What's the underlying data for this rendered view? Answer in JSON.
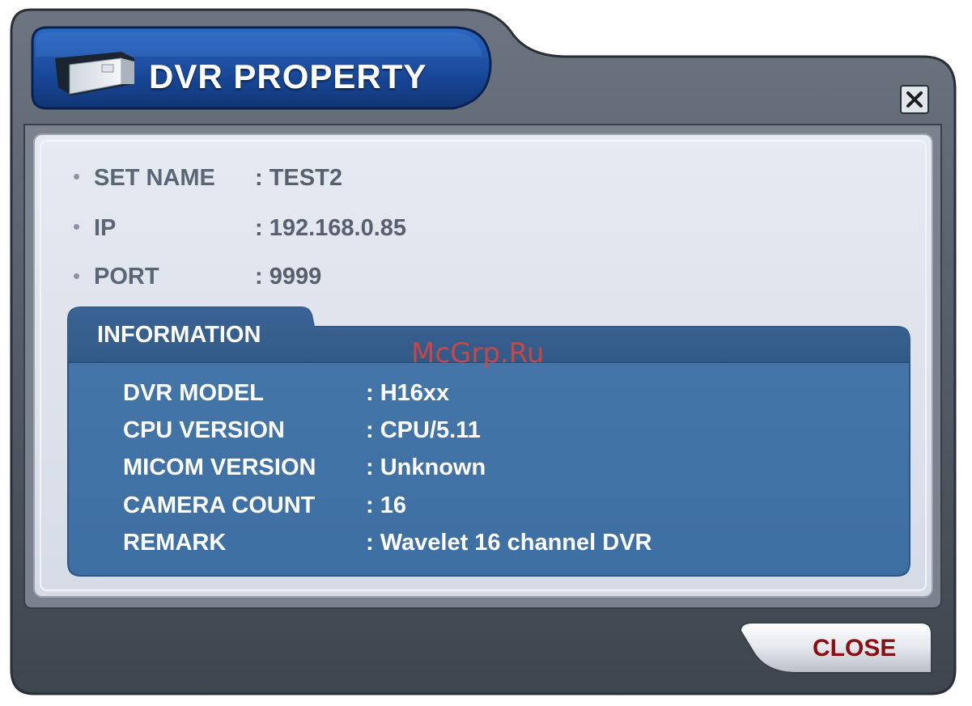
{
  "window": {
    "title": "DVR PROPERTY"
  },
  "properties": [
    {
      "label": "SET NAME",
      "value": ": TEST2"
    },
    {
      "label": "IP",
      "value": ": 192.168.0.85"
    },
    {
      "label": "PORT",
      "value": ": 9999"
    }
  ],
  "information": {
    "tab_label": "INFORMATION",
    "rows": [
      {
        "label": "DVR MODEL",
        "value": ": H16xx"
      },
      {
        "label": "CPU VERSION",
        "value": ": CPU/5.11"
      },
      {
        "label": "MICOM VERSION",
        "value": ": Unknown"
      },
      {
        "label": "CAMERA COUNT",
        "value": ": 16"
      },
      {
        "label": "REMARK",
        "value": ": Wavelet 16 channel DVR"
      }
    ]
  },
  "watermark": "McGrp.Ru",
  "buttons": {
    "close_label": "CLOSE"
  },
  "icons": {
    "title_icon": "dvr-device-icon",
    "close_icon": "close-x-icon"
  },
  "colors": {
    "header_blue": "#1c50a8",
    "panel_blue": "#3f72a6",
    "panel_bg": "#dde2ec",
    "frame_gray": "#4e5660",
    "close_text": "#8a0f14"
  }
}
